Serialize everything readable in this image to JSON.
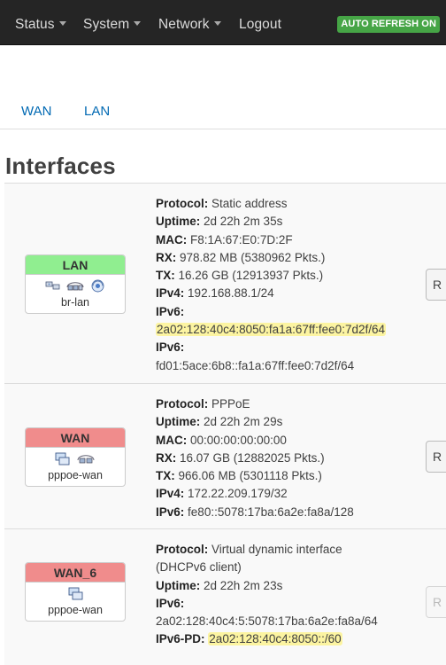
{
  "nav": {
    "items": [
      "Status",
      "System",
      "Network",
      "Logout"
    ],
    "auto_refresh": "AUTO REFRESH ON"
  },
  "tabs": [
    "WAN",
    "LAN"
  ],
  "section_title": "Interfaces",
  "interfaces": [
    {
      "name": "LAN",
      "device": "br-lan",
      "header_color": "#90ee90",
      "icons": [
        "switch-icon",
        "ethernet-bridge-icon",
        "wifi-icon"
      ],
      "lines": [
        {
          "k": "Protocol:",
          "v": "Static address"
        },
        {
          "k": "Uptime:",
          "v": "2d 22h 2m 35s"
        },
        {
          "k": "MAC:",
          "v": "F8:1A:67:E0:7D:2F"
        },
        {
          "k": "RX:",
          "v": "978.82 MB (5380962 Pkts.)"
        },
        {
          "k": "TX:",
          "v": "16.26 GB (12913937 Pkts.)"
        },
        {
          "k": "IPv4:",
          "v": "192.168.88.1/24"
        },
        {
          "k": "IPv6:",
          "v": ""
        },
        {
          "k": "",
          "v": "2a02:128:40c4:8050:fa1a:67ff:fee0:7d2f/64"
        },
        {
          "k": "IPv6:",
          "v": ""
        },
        {
          "k": "",
          "v": "fd01:5ace:6b8::fa1a:67ff:fee0:7d2f/64"
        }
      ],
      "button": "R"
    },
    {
      "name": "WAN",
      "device": "pppoe-wan",
      "header_color": "#f08c8c",
      "icons": [
        "network-computer-icon",
        "ethernet-icon"
      ],
      "lines": [
        {
          "k": "Protocol:",
          "v": "PPPoE"
        },
        {
          "k": "Uptime:",
          "v": "2d 22h 2m 29s"
        },
        {
          "k": "MAC:",
          "v": "00:00:00:00:00:00"
        },
        {
          "k": "RX:",
          "v": "16.07 GB (12882025 Pkts.)"
        },
        {
          "k": "TX:",
          "v": "966.06 MB (5301118 Pkts.)"
        },
        {
          "k": "IPv4:",
          "v": "172.22.209.179/32"
        },
        {
          "k": "IPv6:",
          "v": "fe80::5078:17ba:6a2e:fa8a/128"
        }
      ],
      "button": "R"
    },
    {
      "name": "WAN_6",
      "device": "pppoe-wan",
      "header_color": "#f08c8c",
      "icons": [
        "network-computer-icon"
      ],
      "lines": [
        {
          "k": "Protocol:",
          "v": "Virtual dynamic interface"
        },
        {
          "k": "",
          "v": "(DHCPv6 client)"
        },
        {
          "k": "Uptime:",
          "v": "2d 22h 2m 23s"
        },
        {
          "k": "IPv6:",
          "v": ""
        },
        {
          "k": "",
          "v": "2a02:128:40c4:5:5078:17ba:6a2e:fa8a/64"
        },
        {
          "k": "IPv6-PD:",
          "v": "2a02:128:40c4:8050::/60"
        }
      ],
      "button": "R"
    }
  ]
}
